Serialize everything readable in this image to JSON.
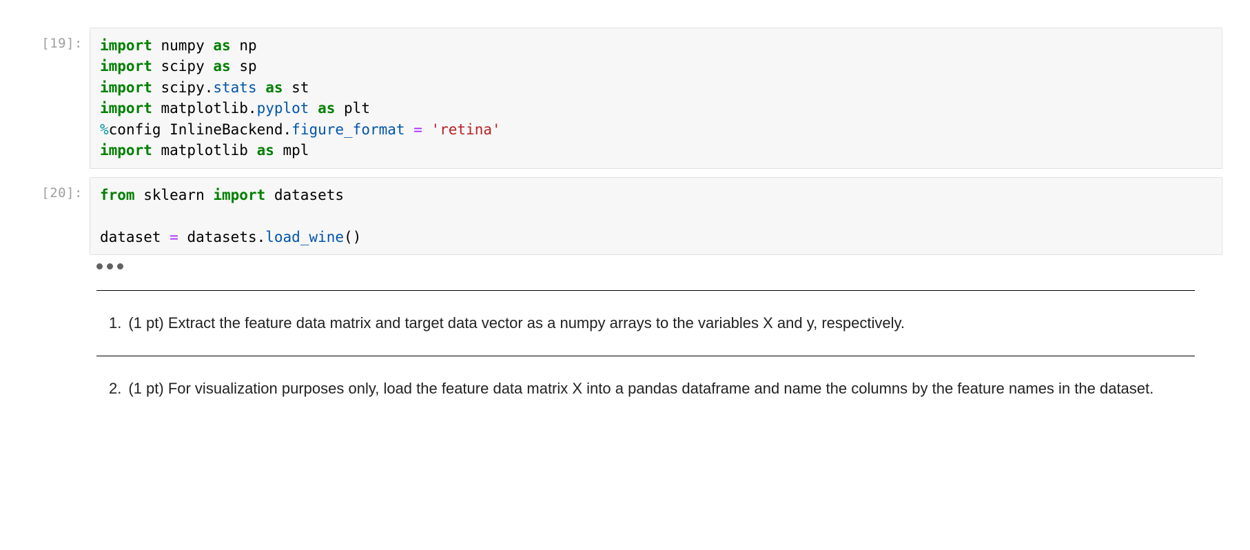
{
  "cells": {
    "cell1": {
      "prompt": "[19]:",
      "line1": {
        "import": "import",
        "name": " numpy ",
        "as": "as",
        "alias": " np"
      },
      "line2": {
        "import": "import",
        "name": " scipy ",
        "as": "as",
        "alias": " sp"
      },
      "line3": {
        "import": "import",
        "name": " scipy.",
        "attr": "stats ",
        "as": "as",
        "alias": " st"
      },
      "line4": {
        "import": "import",
        "name": " matplotlib.",
        "attr": "pyplot ",
        "as": "as",
        "alias": " plt"
      },
      "line5": {
        "magic": "%",
        "name1": "config InlineBackend.",
        "attr": "figure_format ",
        "op": "=",
        "str": " 'retina'"
      },
      "line6": {
        "import": "import",
        "name": " matplotlib ",
        "as": "as",
        "alias": " mpl"
      }
    },
    "cell2": {
      "prompt": "[20]:",
      "line1": {
        "from": "from",
        "name1": " sklearn ",
        "import": "import",
        "name2": " datasets"
      },
      "line3": {
        "name1": "dataset ",
        "op": "=",
        "name2": " datasets.",
        "attr": "load_wine",
        "paren": "()"
      }
    }
  },
  "questions": {
    "q1": {
      "num": "1.",
      "text": "(1 pt) Extract the feature data matrix and target data vector as a numpy arrays to the variables X and y, respectively."
    },
    "q2": {
      "num": "2.",
      "text": "(1 pt) For visualization purposes only, load the feature data matrix X into a pandas dataframe and name the columns by the feature names in the dataset."
    }
  }
}
